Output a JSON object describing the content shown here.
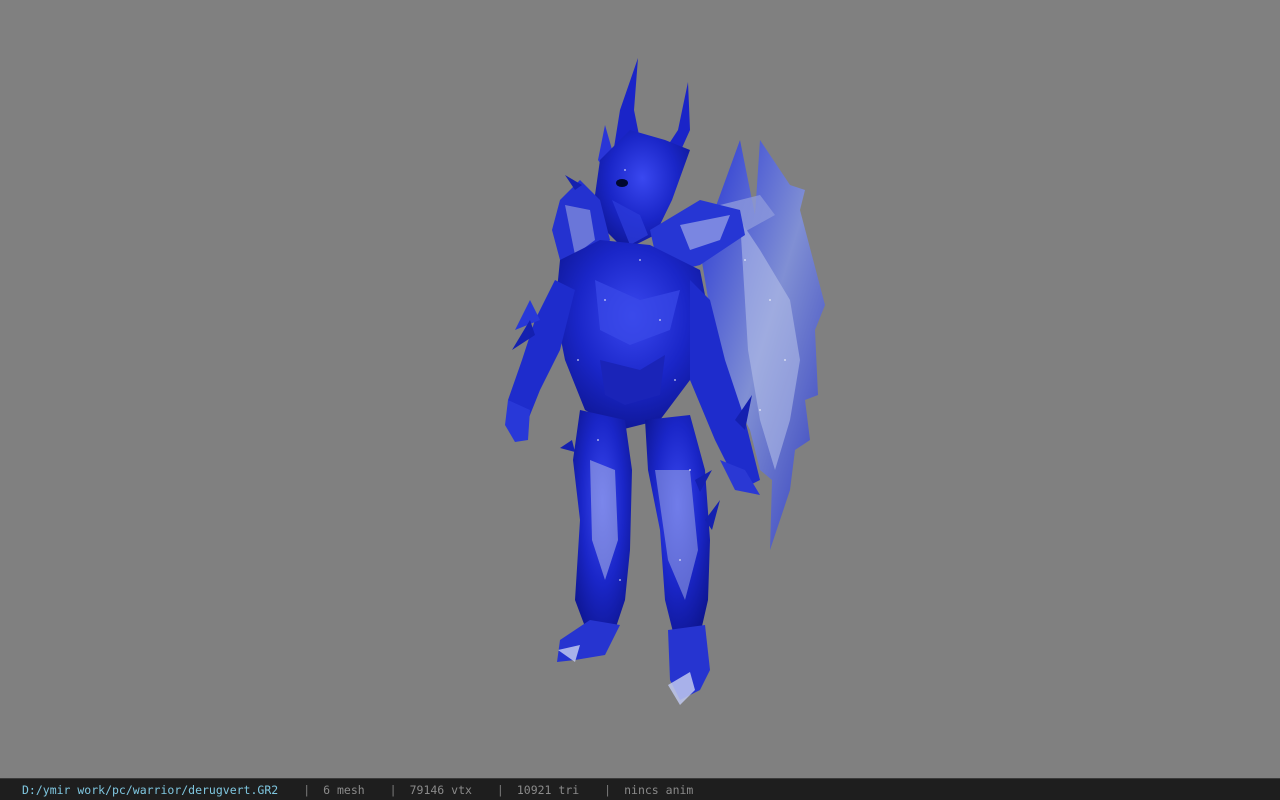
{
  "viewport": {
    "background": "#808080",
    "model": {
      "description_icon": "armored-warrior-model",
      "primary_color": "#1a2bd4",
      "highlight_color": "#b8c4e8"
    }
  },
  "statusbar": {
    "file_path": "D:/ymir work/pc/warrior/derugvert.GR2",
    "separator": "|",
    "mesh_count": "6 mesh",
    "vertex_count": "79146 vtx",
    "triangle_count": "10921 tri",
    "anim_status": "nincs anim"
  }
}
